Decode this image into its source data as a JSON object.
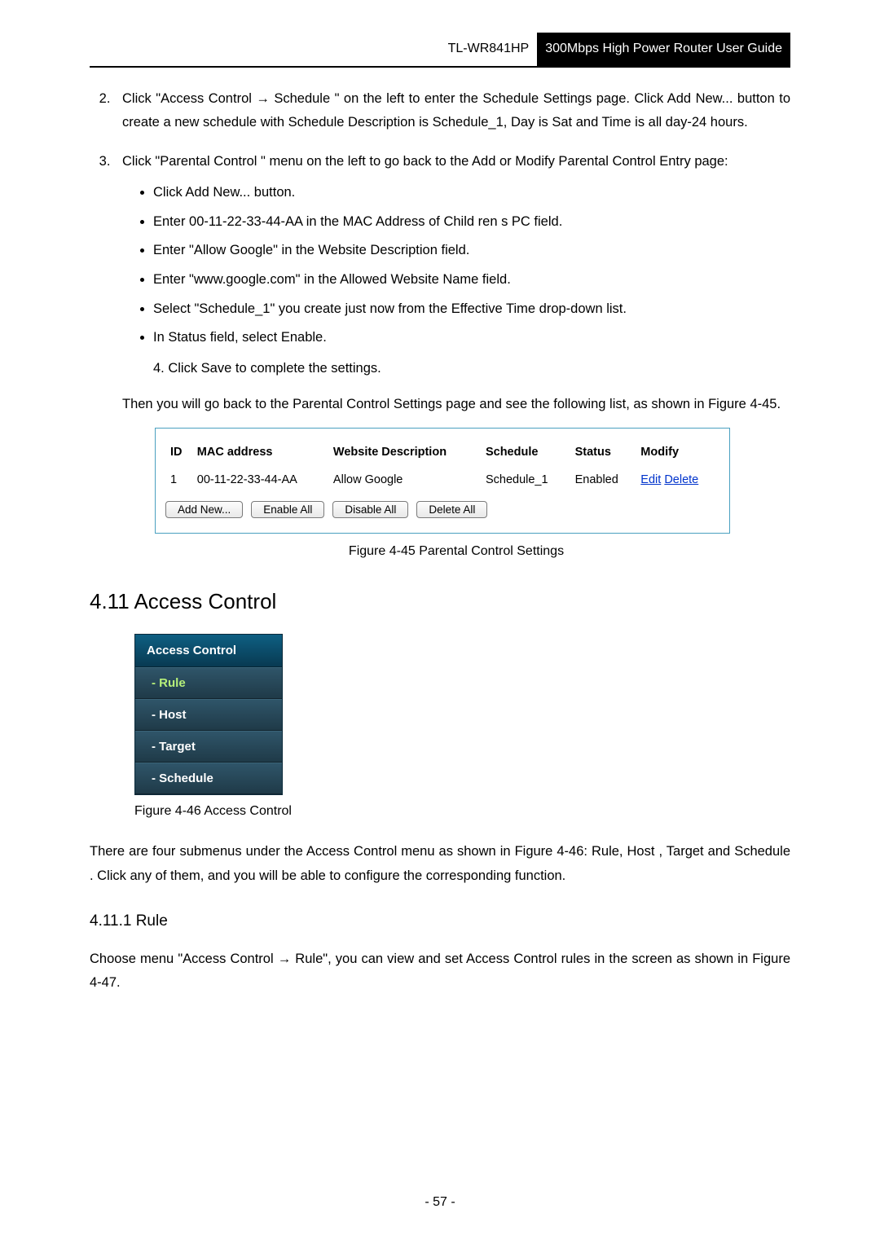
{
  "header": {
    "model": "TL-WR841HP",
    "title": "300Mbps High Power  Router  User Guide"
  },
  "steps": {
    "s2": "Click \"Access Control → Schedule \" on the left to enter the Schedule Settings page. Click Add New... button to create a new schedule with Schedule Description is Schedule_1, Day is Sat and Time is all day-24 hours.",
    "s3": "Click \"Parental Control \" menu on the left to go back to the Add or Modify Parental Control Entry page:",
    "bullets": {
      "b1": "Click Add New...  button.",
      "b2": "Enter 00-11-22-33-44-AA in the MAC Address of Child ren s PC field.",
      "b3": "Enter \"Allow Google\" in the Website Description  field.",
      "b4": "Enter \"www.google.com\" in the Allowed  Website  Name field.",
      "b5": "Select \"Schedule_1\" you create just now from the Effective Time  drop-down list.",
      "b6": "In Status field, select Enable."
    },
    "s4": "4.  Click Save to complete the settings.",
    "after": "Then you will go back to the Parental Control Settings page and see the following list, as shown in Figure 4-45."
  },
  "table": {
    "headers": {
      "id": "ID",
      "mac": "MAC address",
      "desc": "Website Description",
      "schedule": "Schedule",
      "status": "Status",
      "modify": "Modify"
    },
    "rows": [
      {
        "id": "1",
        "mac": "00-11-22-33-44-AA",
        "desc": "Allow Google",
        "schedule": "Schedule_1",
        "status": "Enabled",
        "edit": "Edit",
        "delete": "Delete"
      }
    ],
    "buttons": {
      "add": "Add New...",
      "enable": "Enable All",
      "disable": "Disable All",
      "delete": "Delete All"
    }
  },
  "captions": {
    "fig45": "Figure 4-45   Parental Control Settings",
    "fig46": "Figure 4-46 Access Control"
  },
  "section": {
    "h2": "4.11 Access Control",
    "menu": {
      "head": "Access Control",
      "rule": "- Rule",
      "host": "- Host",
      "target": "- Target",
      "schedule": "- Schedule"
    },
    "para": "There are four submenus under the Access Control menu as shown in Figure 4-46: Rule, Host , Target and Schedule . Click any of them, and you will be able to configure the corresponding function.",
    "h3": "4.11.1 Rule",
    "para2": "Choose menu \"Access Control  → Rule\", you can view and set Access Control rules in the screen as shown in Figure 4-47."
  },
  "footer": {
    "page": "- 57 -"
  }
}
